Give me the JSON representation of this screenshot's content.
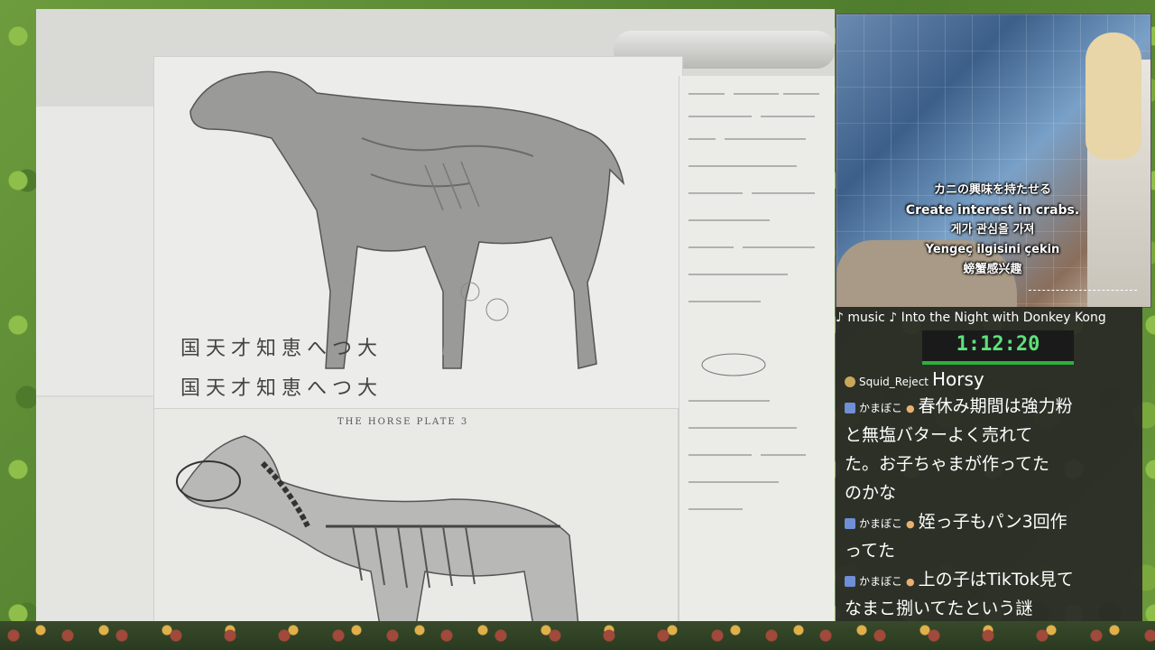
{
  "webcam": {
    "subtitles": [
      "カニの興味を持たせる",
      "Create interest in crabs.",
      "게가 관심을 가져",
      "Yengeç ilgisini çekin",
      "螃蟹感兴趣"
    ]
  },
  "drawing": {
    "plate_title": "THE HORSE   PLATE 3",
    "caption_1": "国天才知恵へつ大",
    "caption_2": "国天才知恵へつ大"
  },
  "chat": {
    "now_playing": "music ♪ Into the Night with Donkey Kong",
    "timer": "1:12:20",
    "messages": [
      {
        "user": "Squid_Reject",
        "lines": [
          "Horsy"
        ]
      },
      {
        "user": "かまぼこ",
        "lines": [
          "春休み期間は強力粉",
          "と無塩バターよく売れて",
          "た。お子ちゃまが作ってた",
          "のかな"
        ]
      },
      {
        "user": "かまぼこ",
        "lines": [
          "姪っ子もパン3回作",
          "ってた"
        ]
      },
      {
        "user": "かまぼこ",
        "lines": [
          "上の子はTikTok見て",
          "なまこ捌いてたという謎"
        ]
      }
    ]
  }
}
